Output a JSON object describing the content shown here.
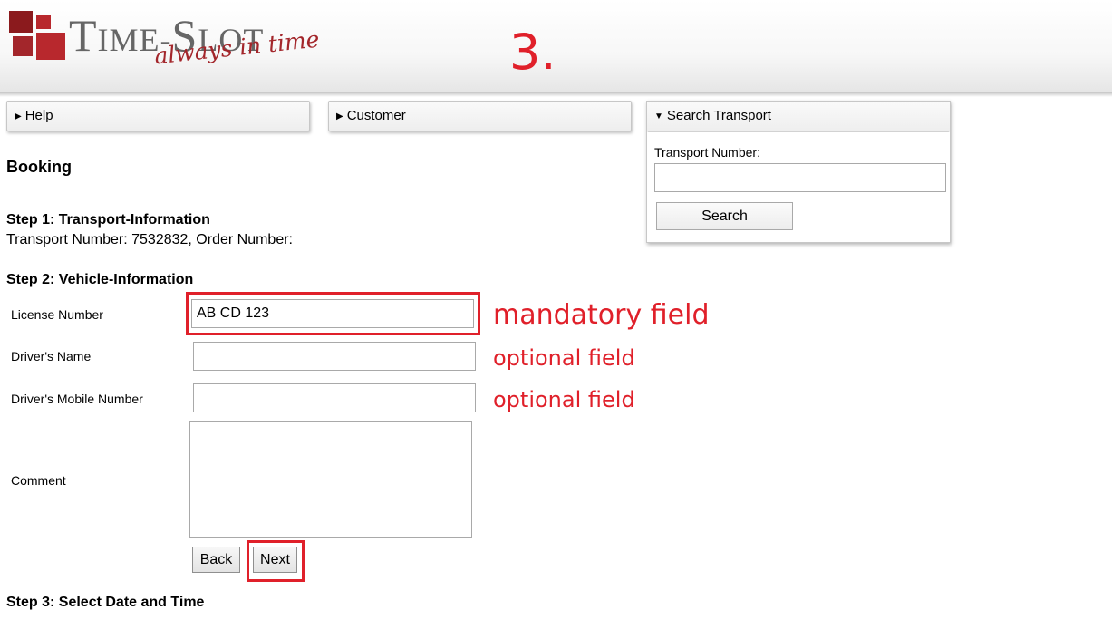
{
  "header": {
    "logo": {
      "word_big_1": "T",
      "word_small_1": "IME-",
      "word_big_2": "S",
      "word_small_2": "LOT",
      "tagline": "always in time"
    },
    "step_marker": "3."
  },
  "nav": {
    "help_label": "Help",
    "customer_label": "Customer",
    "search_transport_label": "Search Transport",
    "collapsed_indicator": "▶",
    "expanded_indicator": "▼"
  },
  "search": {
    "transport_number_label": "Transport Number:",
    "transport_number_value": "",
    "search_button_label": "Search"
  },
  "booking": {
    "title": "Booking",
    "step1": {
      "heading": "Step 1: Transport-Information",
      "info": "Transport Number: 7532832, Order Number:"
    },
    "step2": {
      "heading": "Step 2: Vehicle-Information",
      "fields": [
        {
          "label": "License Number",
          "value": "AB CD 123",
          "note": "mandatory field"
        },
        {
          "label": "Driver's Name",
          "value": "",
          "note": "optional field"
        },
        {
          "label": "Driver's Mobile Number",
          "value": "",
          "note": "optional field"
        },
        {
          "label": "Comment",
          "value": ""
        }
      ],
      "back_label": "Back",
      "next_label": "Next"
    },
    "step3": {
      "heading": "Step 3: Select Date and Time"
    }
  },
  "colors": {
    "annotation_red": "#e0202a",
    "logo_red_dark": "#8b1a1d",
    "logo_red": "#b8282d",
    "logo_gray": "#666666"
  }
}
